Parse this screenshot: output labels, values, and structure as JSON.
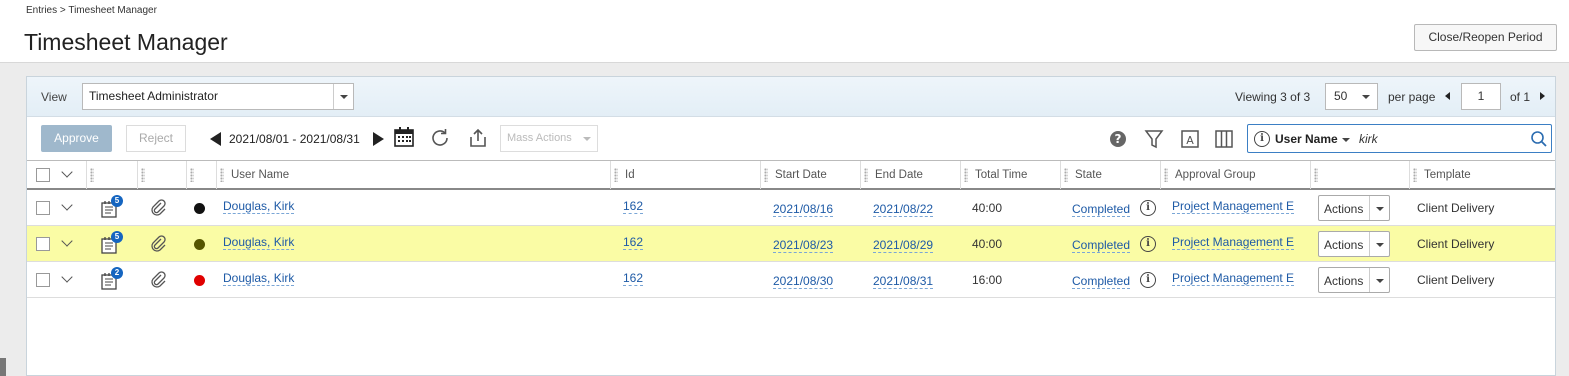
{
  "breadcrumb": "Entries > Timesheet Manager",
  "page_title": "Timesheet Manager",
  "close_reopen_label": "Close/Reopen Period",
  "view": {
    "label": "View",
    "selected": "Timesheet Administrator"
  },
  "paging": {
    "viewing_label": "Viewing",
    "viewing_count": "3 of 3",
    "per_page_value": "50",
    "per_page_label": "per page",
    "page_value": "1",
    "of_label": "of 1"
  },
  "toolbar": {
    "approve_label": "Approve",
    "reject_label": "Reject",
    "date_range": "2021/08/01 - 2021/08/31",
    "mass_actions_label": "Mass Actions",
    "icons": [
      "calendar-icon",
      "refresh-icon",
      "export-icon",
      "help-icon",
      "filter-icon",
      "text-icon",
      "columns-icon"
    ]
  },
  "search": {
    "field_label": "User Name",
    "value": "kirk"
  },
  "columns": {
    "user_name": "User Name",
    "id": "Id",
    "start_date": "Start Date",
    "end_date": "End Date",
    "total_time": "Total Time",
    "state": "State",
    "approval_group": "Approval Group",
    "template": "Template"
  },
  "rows": [
    {
      "badge": "5",
      "dot_color": "#111111",
      "user": "Douglas, Kirk",
      "id": "162",
      "start": "2021/08/16",
      "end": "2021/08/22",
      "total": "40:00",
      "state": "Completed",
      "group": "Project Management E",
      "actions": "Actions",
      "template": "Client Delivery"
    },
    {
      "badge": "5",
      "dot_color": "#555500",
      "user": "Douglas, Kirk",
      "id": "162",
      "start": "2021/08/23",
      "end": "2021/08/29",
      "total": "40:00",
      "state": "Completed",
      "group": "Project Management E",
      "actions": "Actions",
      "template": "Client Delivery"
    },
    {
      "badge": "2",
      "dot_color": "#e00000",
      "user": "Douglas, Kirk",
      "id": "162",
      "start": "2021/08/30",
      "end": "2021/08/31",
      "total": "16:00",
      "state": "Completed",
      "group": "Project Management E",
      "actions": "Actions",
      "template": "Client Delivery"
    }
  ],
  "colors": {
    "accent": "#1e5aa6",
    "highlight_row": "#fafca5",
    "approve_disabled": "#9fb8cc"
  }
}
